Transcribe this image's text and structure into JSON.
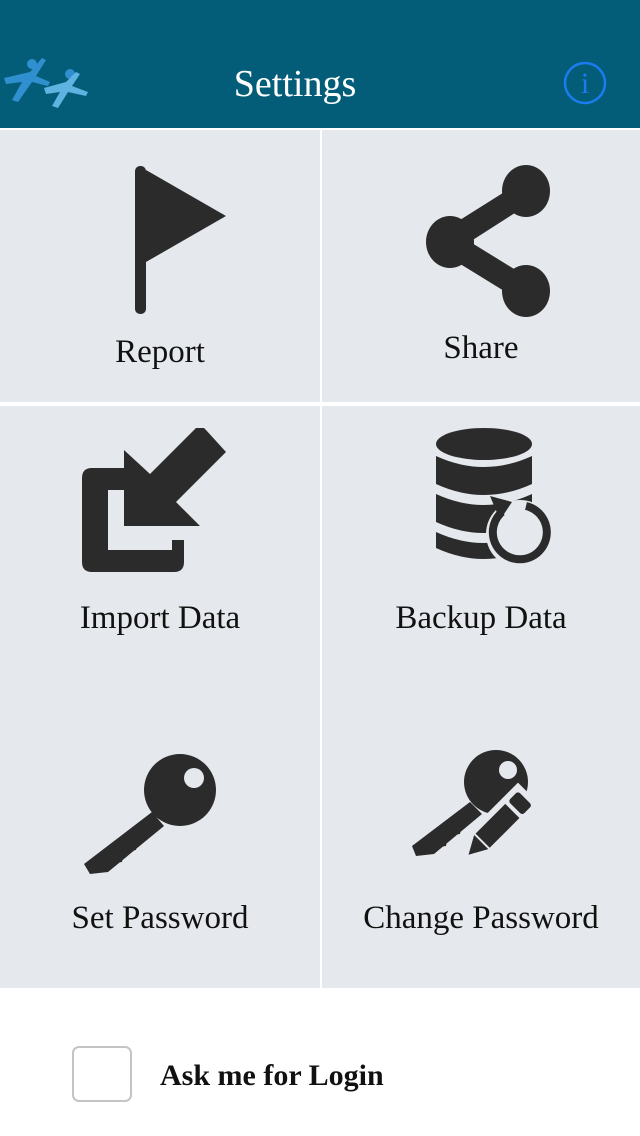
{
  "header": {
    "title": "Settings",
    "logo": "people-logo-icon",
    "info_icon": "info-icon"
  },
  "colors": {
    "header_bg": "#035d78",
    "tile_bg": "#e5e9ed",
    "icon": "#2b2b2b",
    "info_accent": "#1a7cf0",
    "logo": "#2f8fcf"
  },
  "tiles": [
    {
      "label": "Report",
      "icon": "flag-icon"
    },
    {
      "label": "Share",
      "icon": "share-icon"
    },
    {
      "label": "Import Data",
      "icon": "import-icon"
    },
    {
      "label": "Backup Data",
      "icon": "database-backup-icon"
    },
    {
      "label": "Set Password",
      "icon": "key-icon"
    },
    {
      "label": "Change Password",
      "icon": "key-edit-icon"
    }
  ],
  "login_option": {
    "label": "Ask me for Login",
    "checked": false
  }
}
